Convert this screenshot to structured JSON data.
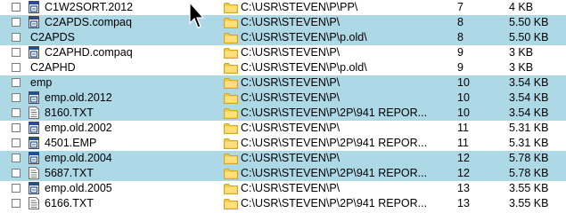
{
  "rows": [
    {
      "name": "C1W2SORT.2012",
      "icon": "app-window-icon",
      "path": "C:\\USR\\STEVEN\\P\\PP\\",
      "num": "7",
      "size": "4 KB",
      "highlight": false
    },
    {
      "name": "C2APDS.compaq",
      "icon": "app-window-icon",
      "path": "C:\\USR\\STEVEN\\P\\",
      "num": "8",
      "size": "5.50 KB",
      "highlight": true
    },
    {
      "name": "C2APDS",
      "icon": "",
      "path": "C:\\USR\\STEVEN\\P\\p.old\\",
      "num": "8",
      "size": "5.50 KB",
      "highlight": true
    },
    {
      "name": "C2APHD.compaq",
      "icon": "app-window-icon",
      "path": "C:\\USR\\STEVEN\\P\\",
      "num": "9",
      "size": "3 KB",
      "highlight": false
    },
    {
      "name": "C2APHD",
      "icon": "",
      "path": "C:\\USR\\STEVEN\\P\\p.old\\",
      "num": "9",
      "size": "3 KB",
      "highlight": false
    },
    {
      "name": "emp",
      "icon": "",
      "path": "C:\\USR\\STEVEN\\P\\",
      "num": "10",
      "size": "3.54 KB",
      "highlight": true
    },
    {
      "name": "emp.old.2012",
      "icon": "app-window-icon",
      "path": "C:\\USR\\STEVEN\\P\\",
      "num": "10",
      "size": "3.54 KB",
      "highlight": true
    },
    {
      "name": "8160.TXT",
      "icon": "text-file-icon",
      "path": "C:\\USR\\STEVEN\\P\\2P\\941 REPOR...",
      "num": "10",
      "size": "3.54 KB",
      "highlight": true
    },
    {
      "name": "emp.old.2002",
      "icon": "app-window-icon",
      "path": "C:\\USR\\STEVEN\\P\\",
      "num": "11",
      "size": "5.31 KB",
      "highlight": false
    },
    {
      "name": "4501.EMP",
      "icon": "app-window-icon",
      "path": "C:\\USR\\STEVEN\\P\\2P\\941 REPOR...",
      "num": "11",
      "size": "5.31 KB",
      "highlight": false
    },
    {
      "name": "emp.old.2004",
      "icon": "app-window-icon",
      "path": "C:\\USR\\STEVEN\\P\\",
      "num": "12",
      "size": "5.78 KB",
      "highlight": true
    },
    {
      "name": "5687.TXT",
      "icon": "text-file-icon",
      "path": "C:\\USR\\STEVEN\\P\\2P\\941 REPOR...",
      "num": "12",
      "size": "5.78 KB",
      "highlight": true
    },
    {
      "name": "emp.old.2005",
      "icon": "app-window-icon",
      "path": "C:\\USR\\STEVEN\\P\\",
      "num": "13",
      "size": "3.55 KB",
      "highlight": false
    },
    {
      "name": "6166.TXT",
      "icon": "text-file-icon",
      "path": "C:\\USR\\STEVEN\\P\\2P\\941 REPOR...",
      "num": "13",
      "size": "3.55 KB",
      "highlight": false
    }
  ],
  "colors": {
    "highlight": "#add8e6",
    "folder": "#f5c842",
    "folder_dark": "#d9a520",
    "icon_blue": "#1f4e9c"
  },
  "cursor_icon": "mouse-pointer-icon"
}
